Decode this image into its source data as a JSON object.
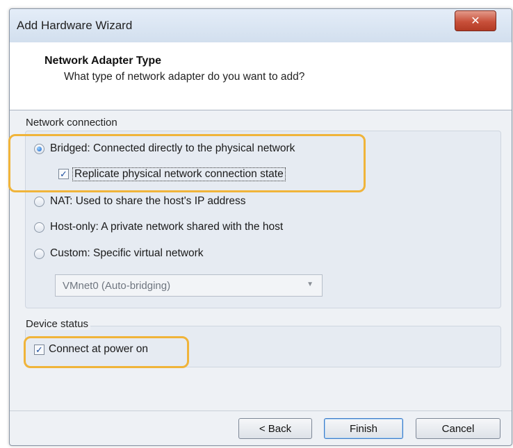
{
  "window": {
    "title": "Add Hardware Wizard",
    "close_glyph": "✕"
  },
  "header": {
    "title": "Network Adapter Type",
    "subtitle": "What type of network adapter do you want to add?"
  },
  "network_connection": {
    "group_label": "Network connection",
    "options": [
      {
        "label": "Bridged: Connected directly to the physical network",
        "checked": true
      },
      {
        "label": "NAT: Used to share the host's IP address",
        "checked": false
      },
      {
        "label": "Host-only: A private network shared with the host",
        "checked": false
      },
      {
        "label": "Custom: Specific virtual network",
        "checked": false
      }
    ],
    "replicate": {
      "label": "Replicate physical network connection state",
      "checked": true
    },
    "custom_network": {
      "value": "VMnet0 (Auto-bridging)"
    }
  },
  "device_status": {
    "group_label": "Device status",
    "connect_on_power": {
      "label": "Connect at power on",
      "checked": true
    }
  },
  "buttons": {
    "back": "< Back",
    "finish": "Finish",
    "cancel": "Cancel"
  },
  "colors": {
    "highlight": "#f0b43a",
    "close_button": "#c8503a"
  },
  "icons": {
    "close": "close-icon",
    "dropdown": "chevron-down-icon",
    "check": "checkmark-icon"
  }
}
